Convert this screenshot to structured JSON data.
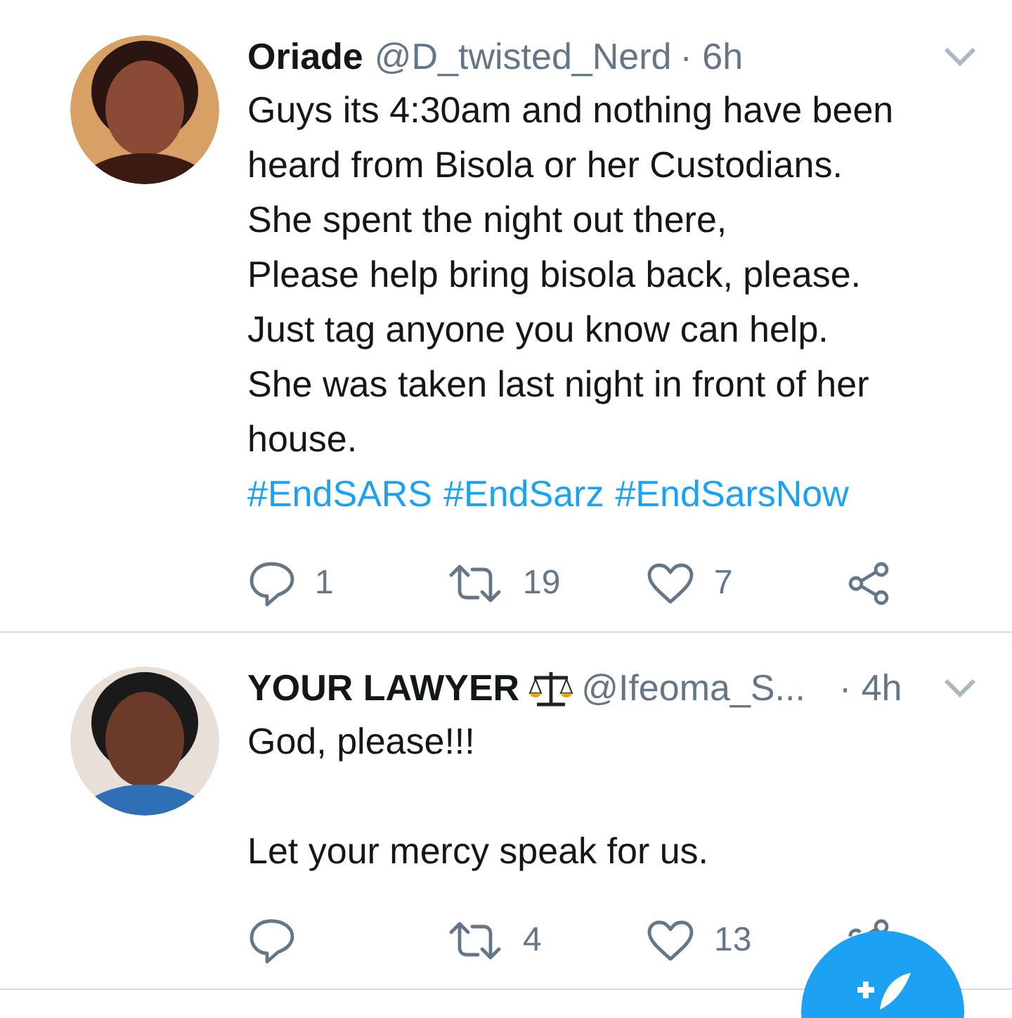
{
  "tweets": [
    {
      "name": "Oriade",
      "handle": "@D_twisted_Nerd",
      "time": "· 6h",
      "body_lines": [
        "Guys its 4:30am and nothing have been",
        "heard from Bisola or her Custodians.",
        "She spent the night out there,",
        "Please help bring bisola back, please.",
        "Just tag anyone you know can help.",
        "She was taken last night in front of her",
        "house."
      ],
      "hashtags": [
        "#EndSARS",
        "#EndSarz",
        "#EndSarsNow"
      ],
      "replies": "1",
      "retweets": "19",
      "likes": "7"
    },
    {
      "name": "YOUR LAWYER",
      "badge": {
        "kind": "scales"
      },
      "handle": "@Ifeoma_S...",
      "time": "· 4h",
      "paragraphs": [
        "God, please!!!",
        "Let your mercy speak for us."
      ],
      "retweets": "4",
      "likes": "13"
    }
  ]
}
